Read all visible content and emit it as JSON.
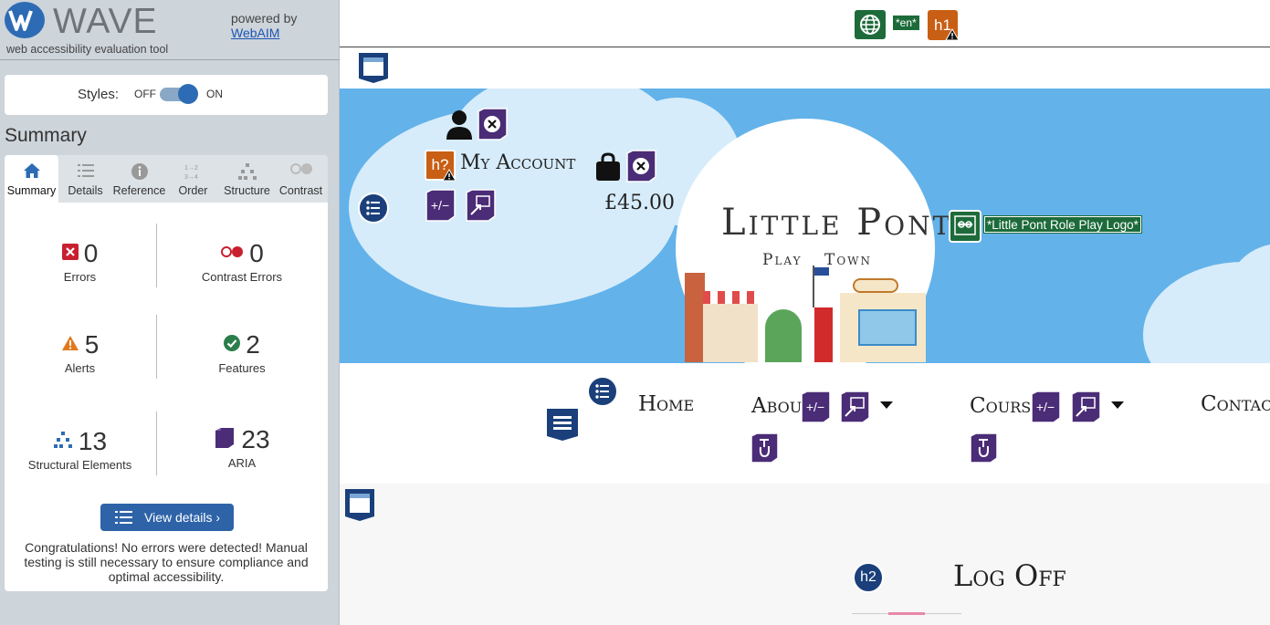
{
  "wave": {
    "title": "WAVE",
    "tagline": "web accessibility evaluation tool",
    "powered_by": "powered by",
    "webaim_link": "WebAIM",
    "styles": {
      "label": "Styles:",
      "off": "OFF",
      "on": "ON",
      "state": "on"
    },
    "summary_title": "Summary",
    "tabs": [
      {
        "label": "Summary",
        "icon": "home-icon",
        "active": true
      },
      {
        "label": "Details",
        "icon": "list-icon",
        "active": false
      },
      {
        "label": "Reference",
        "icon": "info-icon",
        "active": false
      },
      {
        "label": "Order",
        "icon": "order-icon",
        "active": false
      },
      {
        "label": "Structure",
        "icon": "structure-icon",
        "active": false
      },
      {
        "label": "Contrast",
        "icon": "contrast-icon",
        "active": false
      }
    ],
    "stats": {
      "errors": {
        "count": "0",
        "label": "Errors"
      },
      "contrast_errors": {
        "count": "0",
        "label": "Contrast Errors"
      },
      "alerts": {
        "count": "5",
        "label": "Alerts"
      },
      "features": {
        "count": "2",
        "label": "Features"
      },
      "structural": {
        "count": "13",
        "label": "Structural Elements"
      },
      "aria": {
        "count": "23",
        "label": "ARIA"
      }
    },
    "view_details": "View details ›",
    "congrats": "Congratulations! No errors were detected! Manual testing is still necessary to ensure compliance and optimal accessibility."
  },
  "site": {
    "lang_badge": "*en*",
    "h1_badge": "h1",
    "hq_badge": "h?",
    "h2_badge": "h2",
    "account": "My Account",
    "price": "£45.00",
    "logo_title": "Little Pont",
    "logo_sub1": "Play",
    "logo_sub2": "Town",
    "logo_alt": "*Little Pont Role Play Logo*",
    "nav": {
      "home": "Home",
      "about": "About",
      "courses": "Courses",
      "contact": "Contact"
    },
    "heading": "Log Off"
  },
  "colors": {
    "wave_blue": "#2d6bb4",
    "aria_purple": "#4b2c77",
    "alert_orange": "#d4681b",
    "feature_green": "#1d6b3a",
    "structure_navy": "#1a3f7a",
    "banner_sky": "#63b2ea"
  }
}
